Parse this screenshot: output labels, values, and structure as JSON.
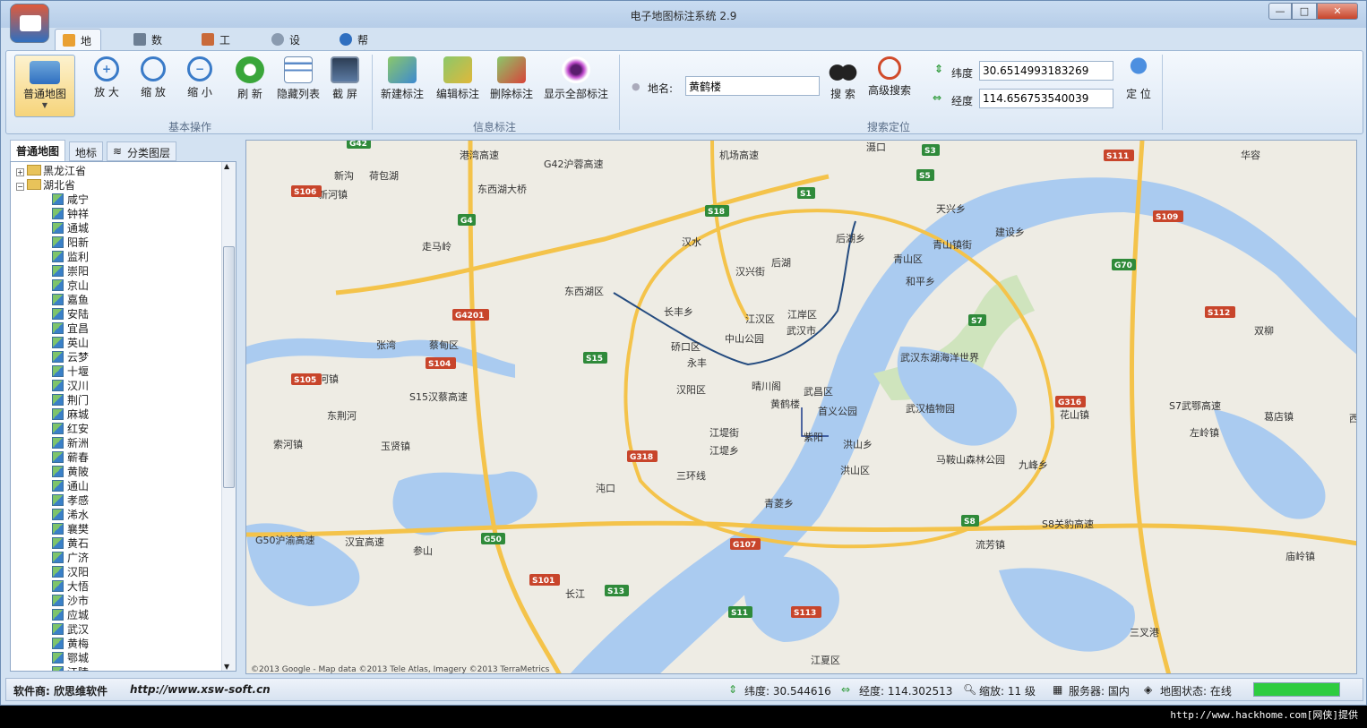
{
  "window": {
    "title": "电子地图标注系统 2.9",
    "min": "—",
    "max": "□",
    "close": "✕"
  },
  "menu_tabs": [
    {
      "label": "地图",
      "icon": "map-icon",
      "color": "#e9a032"
    },
    {
      "label": "数据",
      "icon": "data-icon",
      "color": "#6d7f94"
    },
    {
      "label": "工具",
      "icon": "tools-icon",
      "color": "#c96a3a"
    },
    {
      "label": "设置",
      "icon": "settings-icon",
      "color": "#8a9bb0"
    },
    {
      "label": "帮助",
      "icon": "help-icon",
      "color": "#2f6fc0"
    }
  ],
  "ribbon": {
    "normal_map": "普通地图",
    "basic_ops": {
      "label": "基本操作",
      "zoom_in": "放 大",
      "zoom_out": "缩 放",
      "shrink": "缩 小",
      "refresh": "刷 新",
      "hide_list": "隐藏列表",
      "screenshot": "截 屏"
    },
    "info_mark": {
      "label": "信息标注",
      "new": "新建标注",
      "edit": "编辑标注",
      "delete": "删除标注",
      "show_all": "显示全部标注"
    },
    "search": {
      "label": "搜索定位",
      "place_label": "地名:",
      "place_value": "黄鹤楼",
      "search": "搜 索",
      "adv_search": "高级搜索"
    },
    "coords": {
      "lat_label": "纬度",
      "lat_value": "30.6514993183269",
      "lng_label": "经度",
      "lng_value": "114.656753540039",
      "locate": "定 位"
    }
  },
  "left_tabs": [
    "普通地图",
    "地标",
    "分类图层"
  ],
  "tree": {
    "provinces": [
      "黑龙江省",
      "湖北省"
    ],
    "cities": [
      "咸宁",
      "钟祥",
      "通城",
      "阳新",
      "监利",
      "崇阳",
      "京山",
      "嘉鱼",
      "安陆",
      "宜昌",
      "英山",
      "云梦",
      "十堰",
      "汉川",
      "荆门",
      "麻城",
      "红安",
      "新洲",
      "蕲春",
      "黄陂",
      "通山",
      "孝感",
      "浠水",
      "襄樊",
      "黄石",
      "广济",
      "汉阳",
      "大悟",
      "沙市",
      "应城",
      "武汉",
      "黄梅",
      "鄂城",
      "江陵"
    ]
  },
  "map": {
    "copyright": "©2013 Google - Map data ©2013 Tele Atlas, Imagery ©2013 TerraMetrics",
    "labels": [
      "新沟",
      "荷包湖",
      "新河镇",
      "走马岭",
      "东西湖区",
      "长丰乡",
      "汉兴街",
      "后湖",
      "江岸区",
      "江汉区",
      "武汉市",
      "中山公园",
      "硚口区",
      "永丰",
      "汉阳区",
      "晴川阁",
      "武昌区",
      "黄鹤楼",
      "首义公园",
      "张湾",
      "蔡甸区",
      "索河镇",
      "玉贤镇",
      "江堤街",
      "江堤乡",
      "紫阳",
      "洪山乡",
      "洪山区",
      "沌口",
      "青菱乡",
      "参山",
      "流芳镇",
      "江夏区",
      "青山区",
      "和平乡",
      "天兴乡",
      "建设乡",
      "青山镇街",
      "武汉东湖海洋世界",
      "武汉植物园",
      "马鞍山森林公园",
      "九峰乡",
      "花山镇",
      "左岭镇",
      "葛店镇",
      "双柳",
      "庙岭镇",
      "三叉港",
      "滠口",
      "后湖乡",
      "新河镇",
      "汉水",
      "长江",
      "东荆河",
      "西湖",
      "华容"
    ],
    "roads": [
      "东西湖大桥",
      "G42沪蓉高速",
      "S15汉蔡高速",
      "G50沪渝高速",
      "汉宜高速",
      "三环线",
      "S8关豹高速",
      "S7武鄂高速",
      "机场高速",
      "港湾高速"
    ],
    "shields": [
      "G42",
      "G4",
      "G4201",
      "S18",
      "S1",
      "S3",
      "S5",
      "S7",
      "S8",
      "S13",
      "S11",
      "S15",
      "G50",
      "G70",
      "G318",
      "G316",
      "G107",
      "S111",
      "S109",
      "S112",
      "S104",
      "S105",
      "S106",
      "S101",
      "S113"
    ]
  },
  "status": {
    "vendor": "软件商: 欣思维软件",
    "url": "http://www.xsw-soft.cn",
    "lat": "纬度: 30.544616",
    "lng": "经度: 114.302513",
    "zoom": "缩放: 11 级",
    "server": "服务器: 国内",
    "map_state": "地图状态: 在线",
    "progress": 1.0
  },
  "watermark": "http://www.hackhome.com[网侠]提供"
}
